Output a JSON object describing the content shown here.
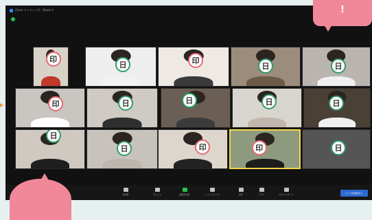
{
  "window": {
    "title": "Zoom ミーティング - Room 4"
  },
  "callout": {
    "top_mark": "!"
  },
  "stamps": {
    "in": "印",
    "hi": "日"
  },
  "tiles": [
    {
      "stamp": "in",
      "bg": "#d9d2c8",
      "top": "#c0392b"
    },
    {
      "stamp": "hi",
      "bg": "#eeeeee",
      "top": "#f2f2f2"
    },
    {
      "stamp": "in",
      "bg": "#efe9e4",
      "top": "#3a3a3a"
    },
    {
      "stamp": "hi",
      "bg": "#9b8c7c",
      "top": "#6d5b4a"
    },
    {
      "stamp": "hi",
      "bg": "#b9b4ae",
      "top": "#f0f0f0"
    },
    {
      "stamp": "in",
      "bg": "#c9c5c0",
      "top": "#ffffff"
    },
    {
      "stamp": "hi",
      "bg": "#cfcac3",
      "top": "#2f2f2f"
    },
    {
      "stamp": "hi",
      "bg": "#6b5f55",
      "top": "#3b3b3b"
    },
    {
      "stamp": "hi",
      "bg": "#d8d4ce",
      "top": "#c1b7ad"
    },
    {
      "stamp": "hi",
      "bg": "#4a4036",
      "top": "#f0f0f0"
    },
    {
      "stamp": "hi",
      "bg": "#cfc9c1",
      "top": "#1e1e1e"
    },
    {
      "stamp": "hi",
      "bg": "#c7c2bb",
      "top": "#bcb6ae"
    },
    {
      "stamp": "in",
      "bg": "#ddd6cc",
      "top": "#222222"
    },
    {
      "stamp": "in",
      "bg": "#8d9a7e",
      "top": "#1d1d1d"
    },
    {
      "stamp": "hi",
      "bg": "#555555",
      "top": "#555555"
    }
  ],
  "toolbar": {
    "buttons": [
      {
        "label": "参加者",
        "icon": "participants-icon",
        "green": false
      },
      {
        "label": "チャット",
        "icon": "chat-icon",
        "green": false
      },
      {
        "label": "画面を共有",
        "icon": "share-screen-icon",
        "green": true
      },
      {
        "label": "レコーディング",
        "icon": "record-icon",
        "green": false
      },
      {
        "label": "反応",
        "icon": "reactions-icon",
        "green": false
      },
      {
        "label": "アプリ",
        "icon": "apps-icon",
        "green": false
      },
      {
        "label": "ホワイトボード",
        "icon": "whiteboard-icon",
        "green": false
      }
    ],
    "leave_label": "ルームを退出する"
  },
  "colors": {
    "stamp_in": "#e56b74",
    "stamp_hi": "#2f9b6a",
    "callout": "#f0889a",
    "active_speaker": "#f2d54c"
  }
}
